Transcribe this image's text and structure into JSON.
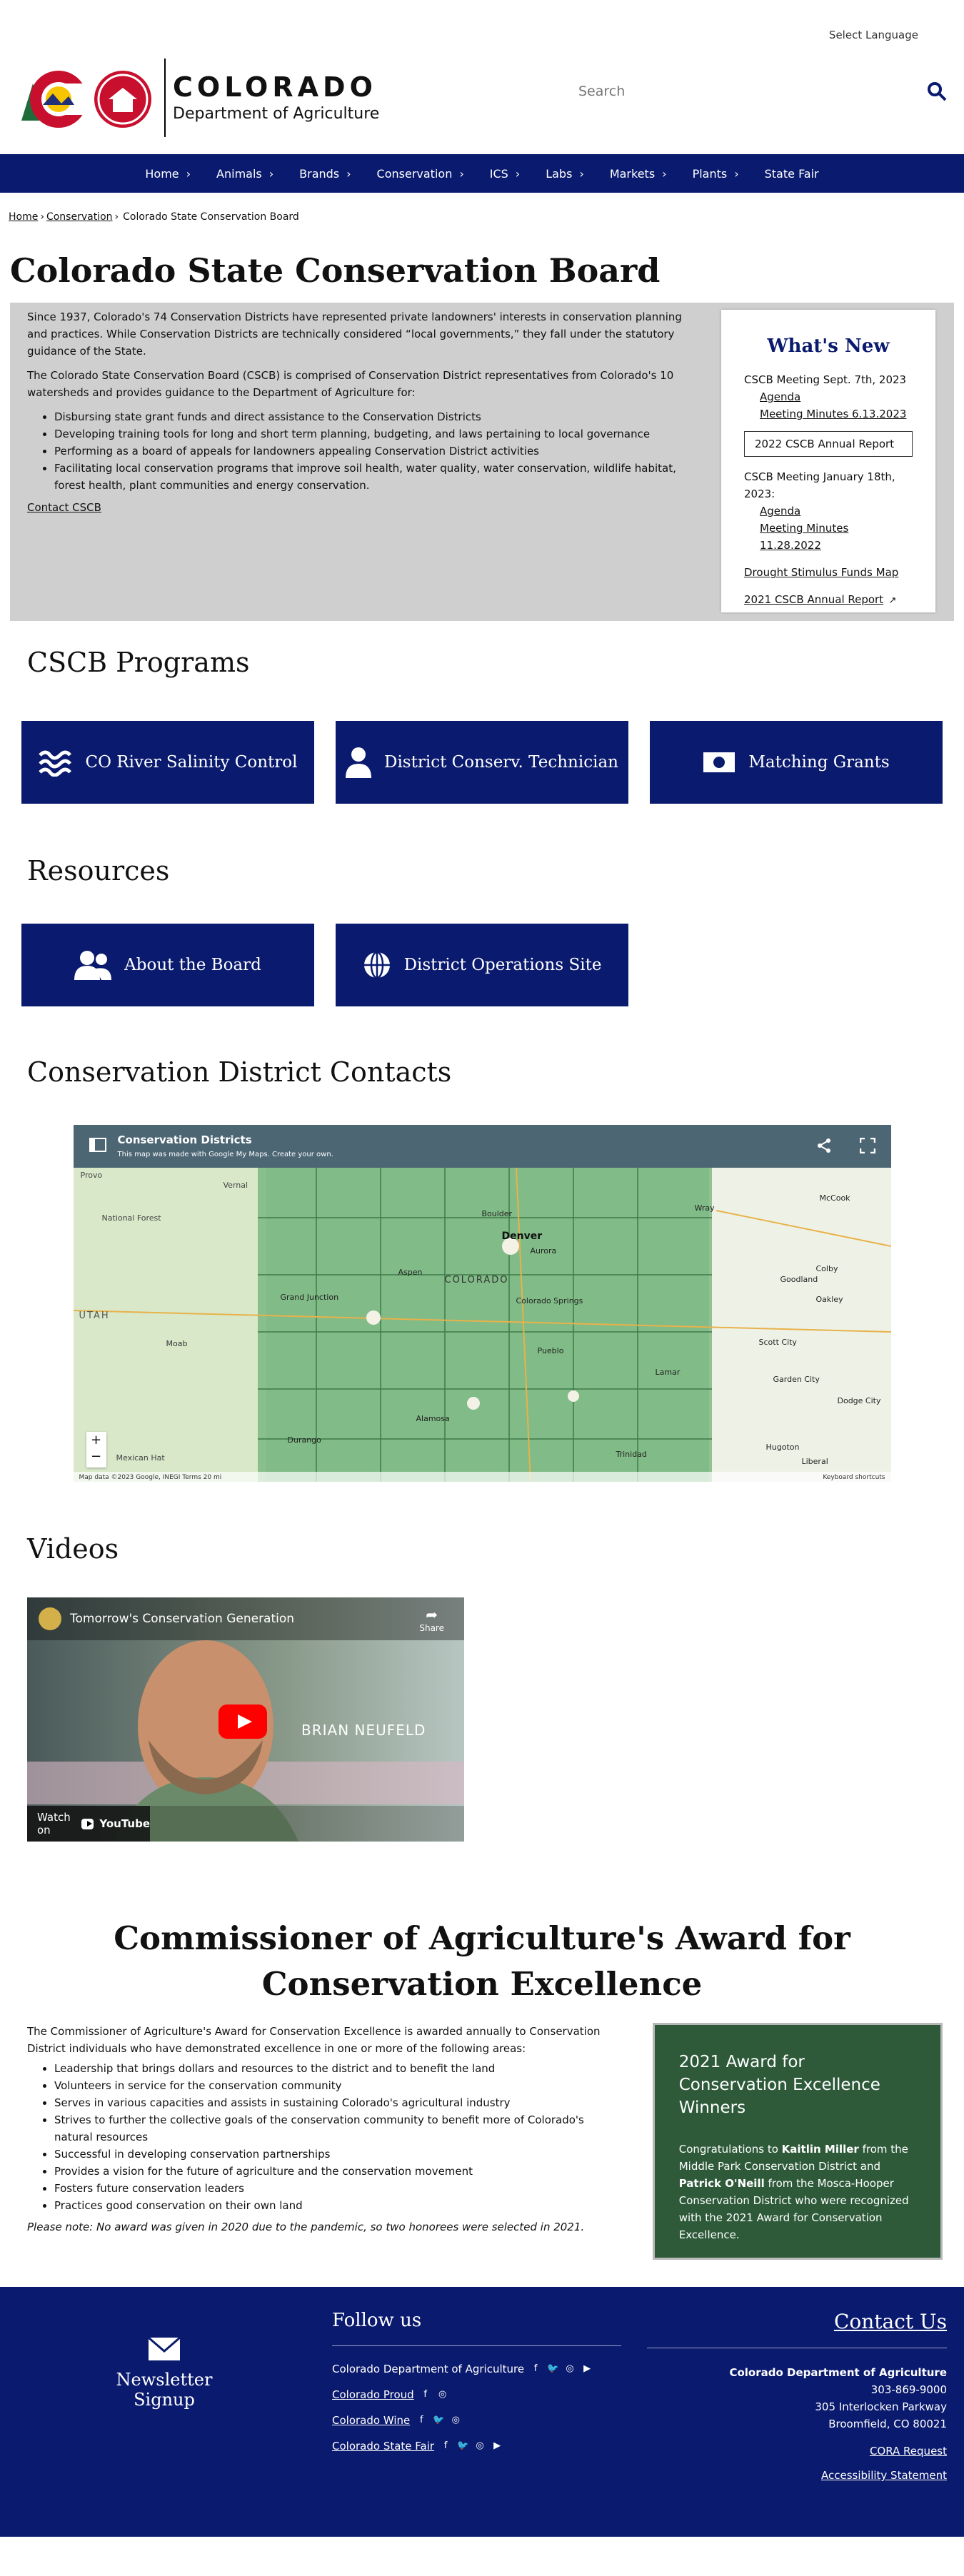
{
  "top": {
    "language": "Select Language"
  },
  "header": {
    "logo_state": "COLORADO",
    "logo_dept": "Department of Agriculture",
    "logo_badge": "CDA",
    "search_placeholder": "Search"
  },
  "nav": {
    "items": [
      "Home",
      "Animals",
      "Brands",
      "Conservation",
      "ICS",
      "Labs",
      "Markets",
      "Plants",
      "State Fair"
    ]
  },
  "breadcrumb": {
    "home": "Home",
    "conservation": "Conservation",
    "current": "Colorado State Conservation Board",
    "sep": "›"
  },
  "page": {
    "title": "Colorado State Conservation Board"
  },
  "intro": {
    "p1": "Since 1937, Colorado's 74 Conservation Districts have represented private landowners' interests in conservation planning and practices. While Conservation Districts are technically considered “local governments,” they fall under the statutory guidance of the State.",
    "p2": "The Colorado State Conservation Board (CSCB) is comprised of Conservation District representatives from Colorado's 10 watersheds and provides guidance to the Department of Agriculture for:",
    "bullets": [
      "Disbursing state grant funds and direct assistance to the Conservation Districts",
      "Developing training tools for long and short term planning, budgeting, and laws pertaining to local governance",
      "Performing as a board of appeals for landowners appealing Conservation District activities",
      "Facilitating local conservation programs that improve soil health, water quality, water conservation, wildlife habitat, forest health, plant communities and energy conservation."
    ],
    "contact_link": "Contact CSCB"
  },
  "whats_new": {
    "title": "What's New",
    "meeting1": "CSCB Meeting Sept. 7th, 2023",
    "agenda1": "Agenda",
    "minutes1": "Meeting Minutes 6.13.2023",
    "report_button": "2022 CSCB Annual Report",
    "meeting2": "CSCB Meeting January 18th, 2023:",
    "agenda2": "Agenda",
    "minutes2": "Meeting Minutes 11.28.2022",
    "stimulus": "Drought Stimulus Funds Map",
    "report2021": "2021 CSCB Annual Report"
  },
  "programs": {
    "title": "CSCB Programs",
    "tiles": [
      "CO River Salinity Control",
      "District Conserv. Technician",
      "Matching Grants"
    ]
  },
  "resources": {
    "title": "Resources",
    "tiles": [
      "About the Board",
      "District Operations Site"
    ]
  },
  "contacts": {
    "title": "Conservation District Contacts",
    "map_title": "Conservation Districts",
    "map_sub": "This map was made with Google My Maps. Create your own.",
    "map_state": "COLORADO",
    "map_footer": "Map data ©2023 Google, INEGI   Terms   20 mi",
    "map_shortcuts": "Keyboard shortcuts",
    "map_labels": [
      "Provo",
      "Vernal",
      "UTAH",
      "Moab",
      "Grand Junction",
      "Aspen",
      "Boulder",
      "Denver",
      "Aurora",
      "Colorado Springs",
      "Pueblo",
      "Durango",
      "Alamosa",
      "Wray",
      "McCook",
      "Goodland",
      "Colby",
      "Oakley",
      "Scott City",
      "Garden City",
      "Dodge City",
      "Hugoton",
      "Liberal",
      "Lamar",
      "Trinidad",
      "National Forest",
      "Mexican Hat"
    ]
  },
  "videos": {
    "title": "Videos",
    "video_title": "Tomorrow's Conservation Generation",
    "share": "Share",
    "person": "BRIAN NEUFELD",
    "watch": "Watch on",
    "youtube": "YouTube"
  },
  "award": {
    "title": "Commissioner of Agriculture's Award for Conservation Excellence",
    "intro": "The Commissioner of Agriculture's Award for Conservation Excellence is awarded annually to Conservation District individuals who have demonstrated excellence in one or more of the following areas:",
    "bullets": [
      "Leadership that brings dollars and resources to the district and to benefit the land",
      "Volunteers in service for the conservation community",
      "Serves in various capacities and assists in sustaining Colorado's agricultural industry",
      "Strives to further the collective goals of the conservation community to benefit more of Colorado's natural resources",
      "Successful in developing conservation partnerships",
      "Provides a vision for the future of agriculture and the conservation movement",
      "Fosters future conservation leaders",
      "Practices good conservation on their own land"
    ],
    "note": "Please note: No award was given in 2020 due to the pandemic, so two honorees were selected in 2021.",
    "winner_title": "2021 Award for Conservation Excellence Winners",
    "winner_p1": "Congratulations to ",
    "winner_name1": "Kaitlin Miller",
    "winner_p2": " from the Middle Park Conservation District and ",
    "winner_name2": "Patrick O'Neill",
    "winner_p3": " from the Mosca-Hooper Conservation District who were recognized with the 2021 Award for Conservation Excellence."
  },
  "footer": {
    "newsletter": "Newsletter Signup",
    "follow_title": "Follow us",
    "follow_items": [
      "Colorado Department of Agriculture",
      "Colorado Proud",
      "Colorado Wine",
      "Colorado State Fair"
    ],
    "contact_title": "Contact Us",
    "org": "Colorado Department of Agriculture",
    "phone": "303-869-9000",
    "address1": "305 Interlocken Parkway",
    "address2": "Broomfield, CO 80021",
    "cora": "CORA Request",
    "accessibility": "Accessibility Statement"
  },
  "colors": {
    "navy": "#0a1a6e",
    "green": "#2e5a3a",
    "grey_panel": "#cfcfcf"
  }
}
